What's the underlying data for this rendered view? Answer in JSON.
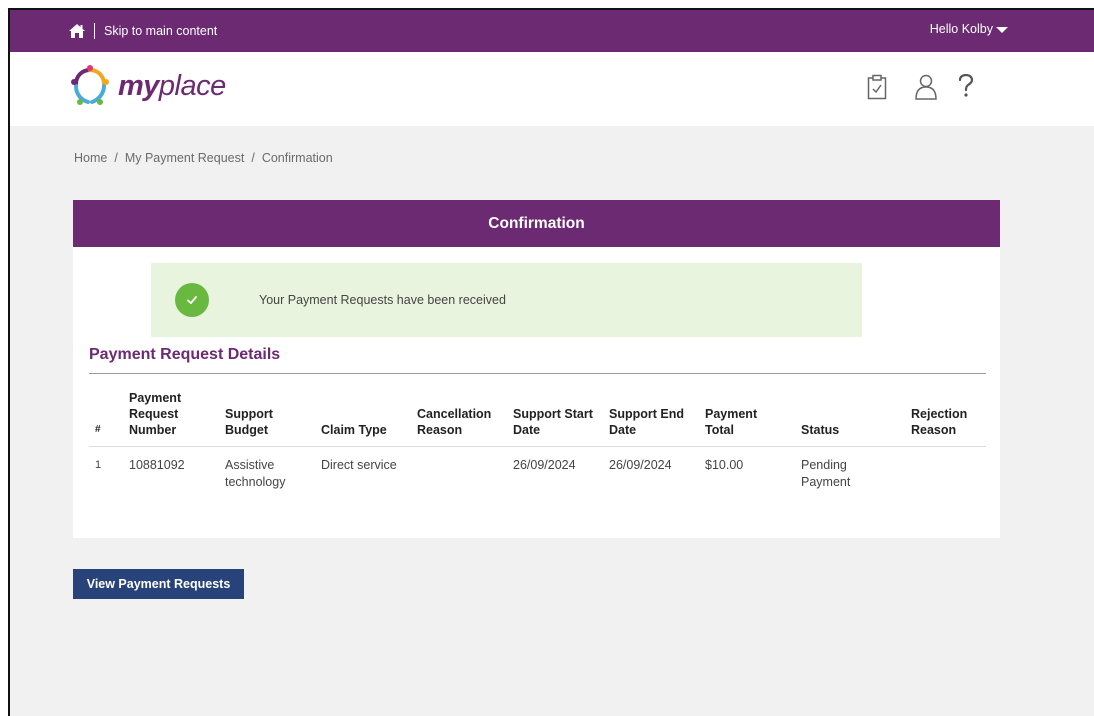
{
  "topbar": {
    "skip_link": "Skip to main content",
    "greeting": "Hello Kolby"
  },
  "header": {
    "logo_bold": "my",
    "logo_light": "place"
  },
  "breadcrumb": [
    "Home",
    "My Payment Request",
    "Confirmation"
  ],
  "confirmation": {
    "title": "Confirmation",
    "success_message": "Your Payment Requests have been received"
  },
  "details": {
    "title": "Payment Request Details",
    "columns": [
      "#",
      "Payment Request Number",
      "Support Budget",
      "Claim Type",
      "Cancellation Reason",
      "Support Start Date",
      "Support End Date",
      "Payment Total",
      "Status",
      "Rejection Reason"
    ],
    "rows": [
      [
        "1",
        "10881092",
        "Assistive technology",
        "Direct service",
        "",
        "26/09/2024",
        "26/09/2024",
        "$10.00",
        "Pending Payment",
        ""
      ]
    ]
  },
  "actions": {
    "view_button": "View Payment Requests"
  },
  "colors": {
    "brand_purple": "#6b2a72",
    "success_bg": "#e8f4de",
    "success_green": "#69b840",
    "button_blue": "#28427a"
  }
}
